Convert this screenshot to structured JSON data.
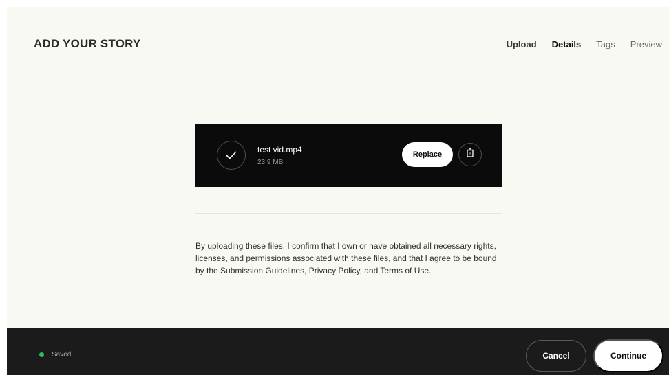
{
  "header": {
    "title": "ADD YOUR STORY",
    "steps": [
      {
        "label": "Upload",
        "state": "completed"
      },
      {
        "label": "Details",
        "state": "active"
      },
      {
        "label": "Tags",
        "state": "inactive"
      },
      {
        "label": "Preview",
        "state": "inactive"
      }
    ]
  },
  "file": {
    "name": "test vid.mp4",
    "size": "23.9 MB",
    "status_icon": "check-icon",
    "replace_label": "Replace",
    "delete_icon": "trash-icon"
  },
  "disclaimer": "By uploading these files, I confirm that I own or have obtained all necessary rights, licenses, and permissions associated with these files, and that I agree to be bound by the Submission Guidelines, Privacy Policy, and Terms of Use.",
  "footer": {
    "status": "Saved",
    "status_color": "#2bbf5b",
    "cancel_label": "Cancel",
    "continue_label": "Continue"
  },
  "colors": {
    "page_background": "#f9f9f4",
    "card_background": "#0b0b0b",
    "footer_background": "#1b1b1b"
  }
}
